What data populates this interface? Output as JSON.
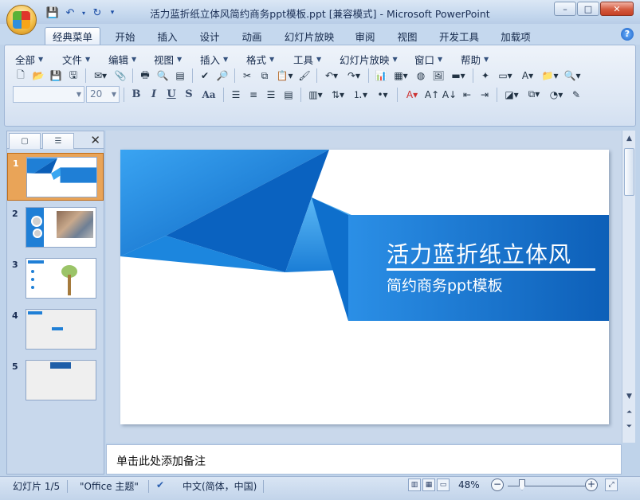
{
  "window": {
    "title": "活力蓝折纸立体风简约商务ppt模板.ppt [兼容模式] - Microsoft PowerPoint",
    "minimize": "–",
    "maximize": "□",
    "close": "✕"
  },
  "ribbon_tabs": [
    {
      "label": "经典菜单",
      "active": true
    },
    {
      "label": "开始"
    },
    {
      "label": "插入"
    },
    {
      "label": "设计"
    },
    {
      "label": "动画"
    },
    {
      "label": "幻灯片放映"
    },
    {
      "label": "审阅"
    },
    {
      "label": "视图"
    },
    {
      "label": "开发工具"
    },
    {
      "label": "加载项"
    }
  ],
  "help_label": "?",
  "menus": [
    "全部",
    "文件",
    "编辑",
    "视图",
    "插入",
    "格式",
    "工具",
    "幻灯片放映",
    "窗口",
    "帮助"
  ],
  "font": {
    "name": "",
    "size": "20"
  },
  "format_buttons": [
    "B",
    "I",
    "U",
    "S",
    "Aa"
  ],
  "slide_panel": {
    "close": "✕",
    "thumbnails": [
      "1",
      "2",
      "3",
      "4",
      "5"
    ]
  },
  "slide": {
    "title": "活力蓝折纸立体风",
    "subtitle": "简约商务ppt模板",
    "colors": {
      "primary": "#1f7fd6",
      "dark": "#0a5eb7",
      "light": "#39a6f1"
    }
  },
  "notes_placeholder": "单击此处添加备注",
  "status": {
    "slide_info": "幻灯片 1/5",
    "theme": "\"Office 主题\"",
    "language": "中文(简体，中国)",
    "zoom": "48%",
    "zoom_level": 0.48
  }
}
